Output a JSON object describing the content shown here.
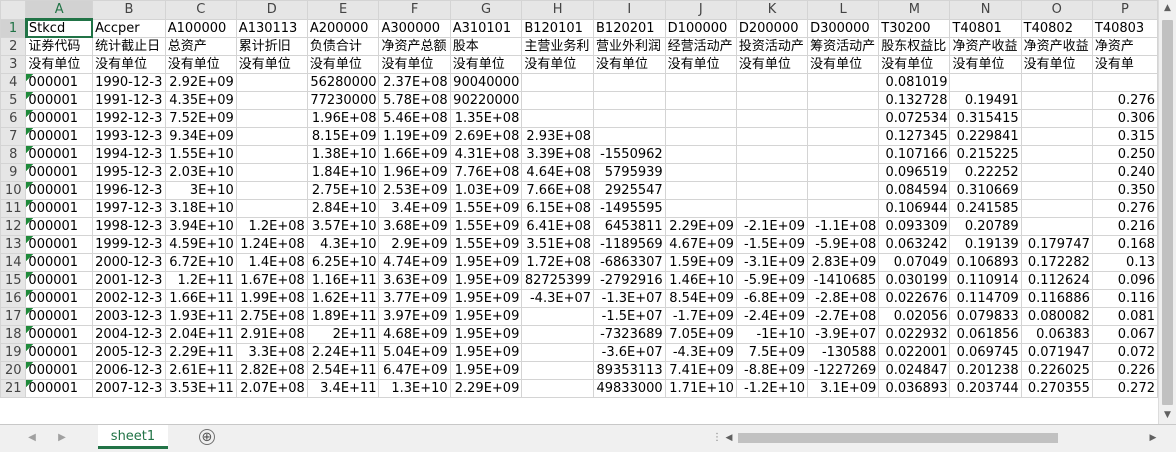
{
  "active_cell": "A1",
  "column_headers": [
    "A",
    "B",
    "C",
    "D",
    "E",
    "F",
    "G",
    "H",
    "I",
    "J",
    "K",
    "L",
    "M",
    "N",
    "O",
    "P"
  ],
  "rows": [
    {
      "n": "1",
      "cells": [
        "Stkcd",
        "Accper",
        "A100000",
        "A130113",
        "A200000",
        "A300000",
        "A310101",
        "B120101",
        "B120201",
        "D100000",
        "D200000",
        "D300000",
        "T30200",
        "T40801",
        "T40802",
        "T40803"
      ]
    },
    {
      "n": "2",
      "cells": [
        "证券代码",
        "统计截止日",
        "总资产",
        "累计折旧",
        "负债合计",
        "净资产总额",
        "股本",
        "主营业务利",
        "营业外利润",
        "经营活动产",
        "投资活动产",
        "筹资活动产",
        "股东权益比",
        "净资产收益",
        "净资产收益",
        "净资产"
      ]
    },
    {
      "n": "3",
      "cells": [
        "没有单位",
        "没有单位",
        "没有单位",
        "没有单位",
        "没有单位",
        "没有单位",
        "没有单位",
        "没有单位",
        "没有单位",
        "没有单位",
        "没有单位",
        "没有单位",
        "没有单位",
        "没有单位",
        "没有单位",
        "没有单"
      ]
    },
    {
      "n": "4",
      "cells": [
        "000001",
        "1990-12-3",
        "2.92E+09",
        "",
        "56280000",
        "2.37E+08",
        "90040000",
        "",
        "",
        "",
        "",
        "",
        "0.081019",
        "",
        "",
        ""
      ]
    },
    {
      "n": "5",
      "cells": [
        "000001",
        "1991-12-3",
        "4.35E+09",
        "",
        "77230000",
        "5.78E+08",
        "90220000",
        "",
        "",
        "",
        "",
        "",
        "0.132728",
        "0.19491",
        "",
        "0.276"
      ]
    },
    {
      "n": "6",
      "cells": [
        "000001",
        "1992-12-3",
        "7.52E+09",
        "",
        "1.96E+08",
        "5.46E+08",
        "1.35E+08",
        "",
        "",
        "",
        "",
        "",
        "0.072534",
        "0.315415",
        "",
        "0.306"
      ]
    },
    {
      "n": "7",
      "cells": [
        "000001",
        "1993-12-3",
        "9.34E+09",
        "",
        "8.15E+09",
        "1.19E+09",
        "2.69E+08",
        "2.93E+08",
        "",
        "",
        "",
        "",
        "0.127345",
        "0.229841",
        "",
        "0.315"
      ]
    },
    {
      "n": "8",
      "cells": [
        "000001",
        "1994-12-3",
        "1.55E+10",
        "",
        "1.38E+10",
        "1.66E+09",
        "4.31E+08",
        "3.39E+08",
        "-1550962",
        "",
        "",
        "",
        "0.107166",
        "0.215225",
        "",
        "0.250"
      ]
    },
    {
      "n": "9",
      "cells": [
        "000001",
        "1995-12-3",
        "2.03E+10",
        "",
        "1.84E+10",
        "1.96E+09",
        "7.76E+08",
        "4.64E+08",
        "5795939",
        "",
        "",
        "",
        "0.096519",
        "0.22252",
        "",
        "0.240"
      ]
    },
    {
      "n": "10",
      "cells": [
        "000001",
        "1996-12-3",
        "3E+10",
        "",
        "2.75E+10",
        "2.53E+09",
        "1.03E+09",
        "7.66E+08",
        "2925547",
        "",
        "",
        "",
        "0.084594",
        "0.310669",
        "",
        "0.350"
      ]
    },
    {
      "n": "11",
      "cells": [
        "000001",
        "1997-12-3",
        "3.18E+10",
        "",
        "2.84E+10",
        "3.4E+09",
        "1.55E+09",
        "6.15E+08",
        "-1495595",
        "",
        "",
        "",
        "0.106944",
        "0.241585",
        "",
        "0.276"
      ]
    },
    {
      "n": "12",
      "cells": [
        "000001",
        "1998-12-3",
        "3.94E+10",
        "1.2E+08",
        "3.57E+10",
        "3.68E+09",
        "1.55E+09",
        "6.41E+08",
        "6453811",
        "2.29E+09",
        "-2.1E+09",
        "-1.1E+08",
        "0.093309",
        "0.20789",
        "",
        "0.216"
      ]
    },
    {
      "n": "13",
      "cells": [
        "000001",
        "1999-12-3",
        "4.59E+10",
        "1.24E+08",
        "4.3E+10",
        "2.9E+09",
        "1.55E+09",
        "3.51E+08",
        "-1189569",
        "4.67E+09",
        "-1.5E+09",
        "-5.9E+08",
        "0.063242",
        "0.19139",
        "0.179747",
        "0.168"
      ]
    },
    {
      "n": "14",
      "cells": [
        "000001",
        "2000-12-3",
        "6.72E+10",
        "1.4E+08",
        "6.25E+10",
        "4.74E+09",
        "1.95E+09",
        "1.72E+08",
        "-6863307",
        "1.59E+09",
        "-3.1E+09",
        "2.83E+09",
        "0.07049",
        "0.106893",
        "0.172282",
        "0.13"
      ]
    },
    {
      "n": "15",
      "cells": [
        "000001",
        "2001-12-3",
        "1.2E+11",
        "1.67E+08",
        "1.16E+11",
        "3.63E+09",
        "1.95E+09",
        "82725399",
        "-2792916",
        "1.46E+10",
        "-5.9E+09",
        "-1410685",
        "0.030199",
        "0.110914",
        "0.112624",
        "0.096"
      ]
    },
    {
      "n": "16",
      "cells": [
        "000001",
        "2002-12-3",
        "1.66E+11",
        "1.99E+08",
        "1.62E+11",
        "3.77E+09",
        "1.95E+09",
        "-4.3E+07",
        "-1.3E+07",
        "8.54E+09",
        "-6.8E+09",
        "-2.8E+08",
        "0.022676",
        "0.114709",
        "0.116886",
        "0.116"
      ]
    },
    {
      "n": "17",
      "cells": [
        "000001",
        "2003-12-3",
        "1.93E+11",
        "2.75E+08",
        "1.89E+11",
        "3.97E+09",
        "1.95E+09",
        "",
        "-1.5E+07",
        "-1.7E+09",
        "-2.4E+09",
        "-2.7E+08",
        "0.02056",
        "0.079833",
        "0.080082",
        "0.081"
      ]
    },
    {
      "n": "18",
      "cells": [
        "000001",
        "2004-12-3",
        "2.04E+11",
        "2.91E+08",
        "2E+11",
        "4.68E+09",
        "1.95E+09",
        "",
        "-7323689",
        "7.05E+09",
        "-1E+10",
        "-3.9E+07",
        "0.022932",
        "0.061856",
        "0.06383",
        "0.067"
      ]
    },
    {
      "n": "19",
      "cells": [
        "000001",
        "2005-12-3",
        "2.29E+11",
        "3.3E+08",
        "2.24E+11",
        "5.04E+09",
        "1.95E+09",
        "",
        "-3.6E+07",
        "-4.3E+09",
        "7.5E+09",
        "-130588",
        "0.022001",
        "0.069745",
        "0.071947",
        "0.072"
      ]
    },
    {
      "n": "20",
      "cells": [
        "000001",
        "2006-12-3",
        "2.61E+11",
        "2.82E+08",
        "2.54E+11",
        "6.47E+09",
        "1.95E+09",
        "",
        "89353113",
        "7.41E+09",
        "-8.8E+09",
        "-1227269",
        "0.024847",
        "0.201238",
        "0.226025",
        "0.226"
      ]
    },
    {
      "n": "21",
      "cells": [
        "000001",
        "2007-12-3",
        "3.53E+11",
        "2.07E+08",
        "3.4E+11",
        "1.3E+10",
        "2.29E+09",
        "",
        "49833000",
        "1.71E+10",
        "-1.2E+10",
        "3.1E+09",
        "0.036893",
        "0.203744",
        "0.270355",
        "0.272"
      ]
    }
  ],
  "sheet_tab": "sheet1",
  "add_sheet_symbol": "⊕",
  "nav_prev_symbol": "◀",
  "nav_next_symbol": "▶",
  "scroll_up_symbol": "▲",
  "scroll_down_symbol": "▼",
  "scroll_left_symbol": "◀",
  "scroll_right_symbol": "▶",
  "split_symbol": "⋮",
  "colors": {
    "accent": "#217346",
    "header_bg": "#e6e6e6",
    "gridline": "#d4d4d4"
  }
}
